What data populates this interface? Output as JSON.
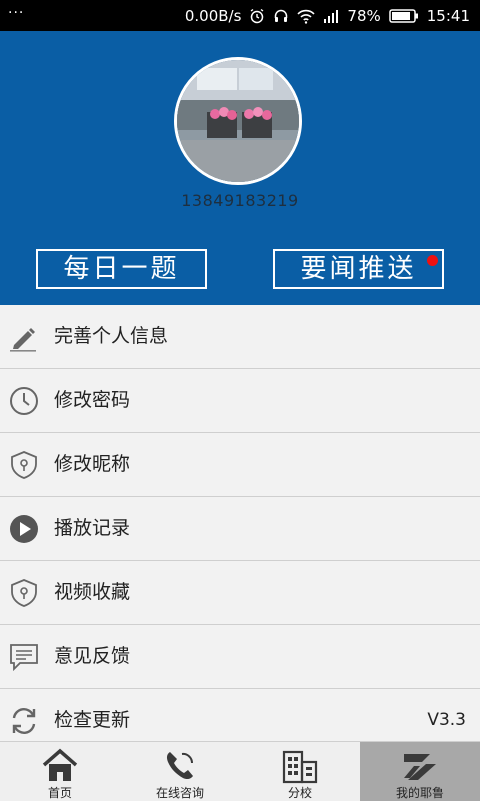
{
  "status_bar": {
    "notification_dots": "···",
    "network_speed": "0.00B/s",
    "battery": "78%",
    "time": "15:41"
  },
  "profile": {
    "phone": "13849183219"
  },
  "header_buttons": {
    "daily_question": "每日一题",
    "news_push": "要闻推送",
    "news_push_has_badge": true
  },
  "menu": {
    "items": [
      {
        "label": "完善个人信息",
        "icon": "pencil-icon"
      },
      {
        "label": "修改密码",
        "icon": "clock-icon"
      },
      {
        "label": "修改昵称",
        "icon": "shield-key-icon"
      },
      {
        "label": "播放记录",
        "icon": "play-icon"
      },
      {
        "label": "视频收藏",
        "icon": "shield-key-icon"
      },
      {
        "label": "意见反馈",
        "icon": "chat-icon"
      },
      {
        "label": "检查更新",
        "icon": "refresh-icon",
        "value": "V3.3"
      }
    ]
  },
  "tabbar": {
    "tabs": [
      {
        "label": "首页",
        "icon": "home-icon"
      },
      {
        "label": "在线咨询",
        "icon": "phone-icon"
      },
      {
        "label": "分校",
        "icon": "building-icon"
      },
      {
        "label": "我的耶鲁",
        "icon": "logo-icon",
        "active": true
      }
    ]
  },
  "colors": {
    "header_bg": "#0a5ea5",
    "badge": "#ee1111",
    "active_tab": "#a8a8a8"
  }
}
